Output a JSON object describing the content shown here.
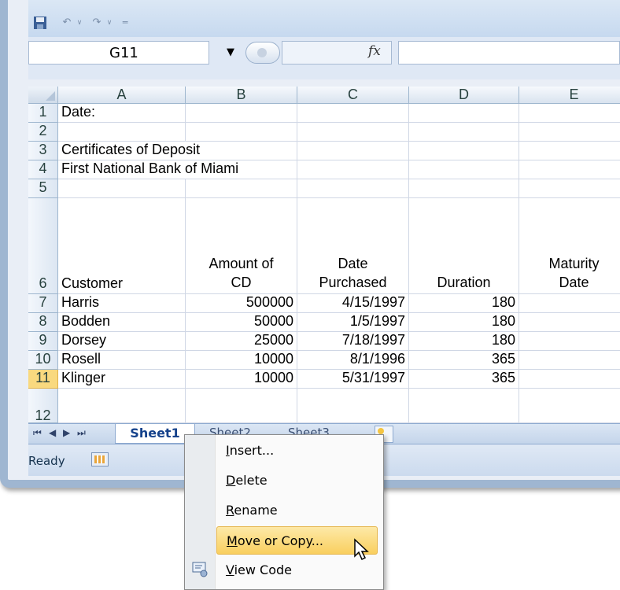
{
  "quick_access": {
    "save_icon": "save-icon",
    "undo_icon": "undo-icon",
    "redo_icon": "redo-icon",
    "customize_icon": "customize-toolbar-icon"
  },
  "formula_bar": {
    "name_box_value": "G11",
    "fx_label": "fx",
    "formula_value": ""
  },
  "grid": {
    "columns": [
      "A",
      "B",
      "C",
      "D",
      "E"
    ],
    "rows": [
      {
        "num": "1",
        "A": "Date:",
        "B": "",
        "C": "",
        "D": "",
        "E": ""
      },
      {
        "num": "2",
        "A": "",
        "B": "",
        "C": "",
        "D": "",
        "E": ""
      },
      {
        "num": "3",
        "A": "Certificates of Deposit",
        "B": "",
        "C": "",
        "D": "",
        "E": ""
      },
      {
        "num": "4",
        "A": "First National Bank of Miami",
        "B": "",
        "C": "",
        "D": "",
        "E": ""
      },
      {
        "num": "5",
        "A": "",
        "B": "",
        "C": "",
        "D": "",
        "E": ""
      },
      {
        "num": "6",
        "A": "Customer",
        "B1": "Amount of",
        "B2": "CD",
        "C1": "Date",
        "C2": "Purchased",
        "D": "Duration",
        "E1": "Maturity",
        "E2": "Date"
      },
      {
        "num": "7",
        "A": "Harris",
        "B": "500000",
        "C": "4/15/1997",
        "D": "180",
        "E": ""
      },
      {
        "num": "8",
        "A": "Bodden",
        "B": "50000",
        "C": "1/5/1997",
        "D": "180",
        "E": ""
      },
      {
        "num": "9",
        "A": "Dorsey",
        "B": "25000",
        "C": "7/18/1997",
        "D": "180",
        "E": ""
      },
      {
        "num": "10",
        "A": "Rosell",
        "B": "10000",
        "C": "8/1/1996",
        "D": "365",
        "E": ""
      },
      {
        "num": "11",
        "A": "Klinger",
        "B": "10000",
        "C": "5/31/1997",
        "D": "365",
        "E": ""
      },
      {
        "num": "12",
        "A": "",
        "B": "",
        "C": "",
        "D": "",
        "E": ""
      }
    ],
    "selected_row": "11",
    "selected_row_color": "#f9d97f"
  },
  "sheet_tabs": {
    "active": "Sheet1",
    "others": [
      "Sheet2",
      "Sheet3"
    ]
  },
  "status": {
    "ready": "Ready"
  },
  "context_menu": {
    "items": [
      {
        "pre": "",
        "u": "I",
        "post": "nsert...",
        "hover": false
      },
      {
        "pre": "",
        "u": "D",
        "post": "elete",
        "hover": false
      },
      {
        "pre": "",
        "u": "R",
        "post": "ename",
        "hover": false
      },
      {
        "pre": "",
        "u": "M",
        "post": "ove or Copy...",
        "hover": true
      },
      {
        "pre": "",
        "u": "V",
        "post": "iew Code",
        "hover": false
      }
    ],
    "hover_color": "#f9cf5f"
  }
}
